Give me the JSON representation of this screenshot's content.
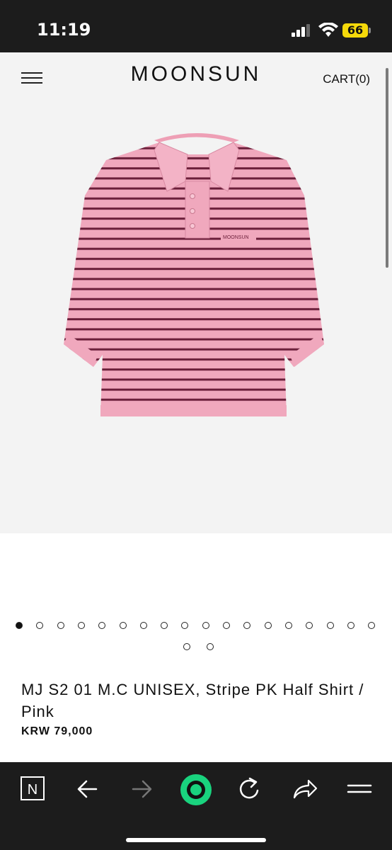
{
  "status_bar": {
    "time": "11:19",
    "battery": "66"
  },
  "header": {
    "brand": "MOONSUN",
    "cart": "CART(0)"
  },
  "product": {
    "name": "MJ S2 01 M.C UNISEX, Stripe PK Half Shirt / Pink",
    "price": "KRW 79,000",
    "shirt_logo": "MOONSUN",
    "colors": {
      "shirt": "#f0a8bd",
      "stripe": "#6b1f3a"
    }
  },
  "gallery": {
    "total_images": 20,
    "active_index": 0
  },
  "browser_bar": {
    "icons": [
      "n-logo-icon",
      "back-arrow-icon",
      "forward-arrow-icon",
      "record-icon",
      "reload-icon",
      "share-icon",
      "menu-icon"
    ],
    "logo_letter": "N"
  }
}
